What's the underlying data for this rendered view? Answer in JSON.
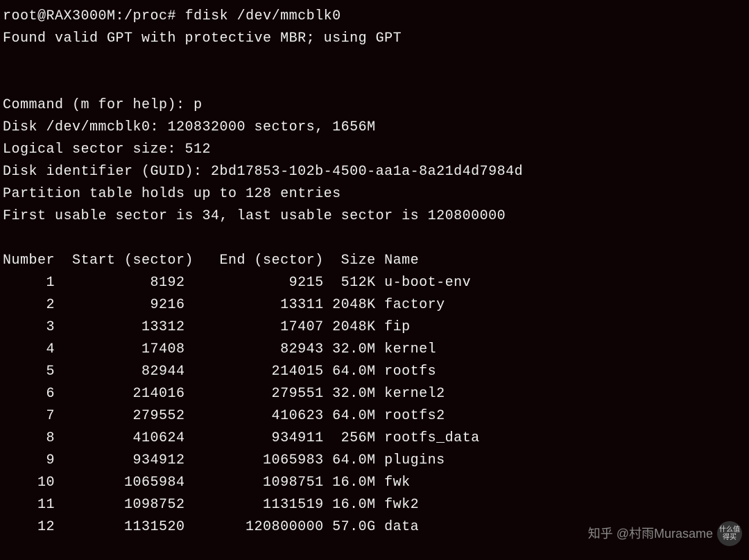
{
  "terminal": {
    "prompt": "root@RAX3000M:/proc#",
    "command": "fdisk /dev/mmcblk0",
    "gpt_message": "Found valid GPT with protective MBR; using GPT",
    "command_prompt": "Command (m for help):",
    "command_input": "p",
    "disk_info": "Disk /dev/mmcblk0: 120832000 sectors, 1656M",
    "sector_size": "Logical sector size: 512",
    "disk_identifier": "Disk identifier (GUID): 2bd17853-102b-4500-aa1a-8a21d4d7984d",
    "partition_table_info": "Partition table holds up to 128 entries",
    "usable_sectors": "First usable sector is 34, last usable sector is 120800000"
  },
  "table": {
    "headers": {
      "number": "Number",
      "start": "Start (sector)",
      "end": "End (sector)",
      "size": "Size",
      "name": "Name"
    },
    "rows": [
      {
        "number": "1",
        "start": "8192",
        "end": "9215",
        "size": "512K",
        "name": "u-boot-env"
      },
      {
        "number": "2",
        "start": "9216",
        "end": "13311",
        "size": "2048K",
        "name": "factory"
      },
      {
        "number": "3",
        "start": "13312",
        "end": "17407",
        "size": "2048K",
        "name": "fip"
      },
      {
        "number": "4",
        "start": "17408",
        "end": "82943",
        "size": "32.0M",
        "name": "kernel"
      },
      {
        "number": "5",
        "start": "82944",
        "end": "214015",
        "size": "64.0M",
        "name": "rootfs"
      },
      {
        "number": "6",
        "start": "214016",
        "end": "279551",
        "size": "32.0M",
        "name": "kernel2"
      },
      {
        "number": "7",
        "start": "279552",
        "end": "410623",
        "size": "64.0M",
        "name": "rootfs2"
      },
      {
        "number": "8",
        "start": "410624",
        "end": "934911",
        "size": "256M",
        "name": "rootfs_data"
      },
      {
        "number": "9",
        "start": "934912",
        "end": "1065983",
        "size": "64.0M",
        "name": "plugins"
      },
      {
        "number": "10",
        "start": "1065984",
        "end": "1098751",
        "size": "16.0M",
        "name": "fwk"
      },
      {
        "number": "11",
        "start": "1098752",
        "end": "1131519",
        "size": "16.0M",
        "name": "fwk2"
      },
      {
        "number": "12",
        "start": "1131520",
        "end": "120800000",
        "size": "57.0G",
        "name": "data"
      }
    ]
  },
  "watermark": {
    "text": "知乎 @村雨Murasame",
    "badge": "什么值得买"
  }
}
